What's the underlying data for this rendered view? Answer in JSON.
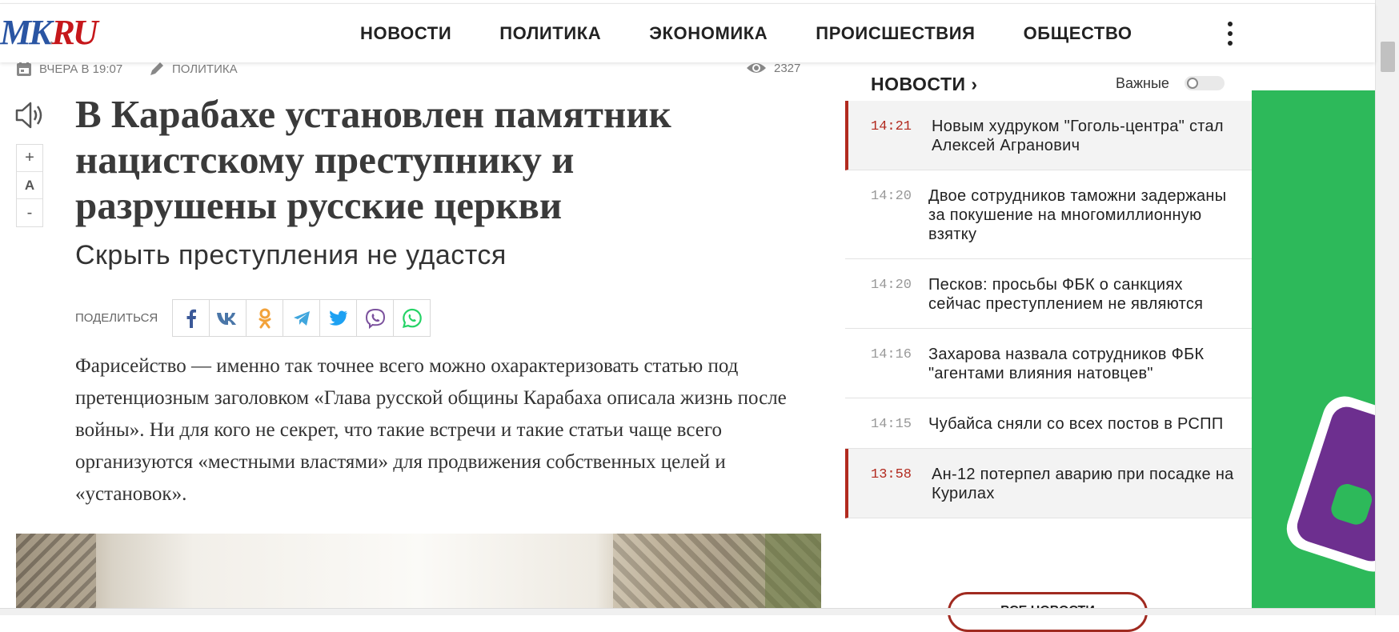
{
  "logo": {
    "mk": "MK",
    "dot": ".",
    "ru": "RU"
  },
  "nav": {
    "items": [
      {
        "label": "НОВОСТИ"
      },
      {
        "label": "ПОЛИТИКА"
      },
      {
        "label": "ЭКОНОМИКА"
      },
      {
        "label": "ПРОИСШЕСТВИЯ"
      },
      {
        "label": "ОБЩЕСТВО"
      }
    ],
    "more_icon": "kebab-menu-icon"
  },
  "article": {
    "date": "ВЧЕРА В 19:07",
    "date_icon": "calendar-icon",
    "rubric": "ПОЛИТИКА",
    "rubric_icon": "pencil-icon",
    "views": "2327",
    "views_icon": "eye-icon",
    "headline": "В Карабахе установлен памятник нацистскому преступнику и разрушены русские церкви",
    "subheadline": "Скрыть преступления не удастся",
    "share_label": "ПОДЕЛИТЬСЯ",
    "share_buttons": [
      {
        "name": "facebook",
        "glyph": "f",
        "color": "#3b5998"
      },
      {
        "name": "vk",
        "glyph": "VK",
        "color": "#4a76a8"
      },
      {
        "name": "odnoklassniki",
        "glyph": "OK",
        "color": "#f2a23a"
      },
      {
        "name": "telegram",
        "glyph": "TG",
        "color": "#40a6dd"
      },
      {
        "name": "twitter",
        "glyph": "TW",
        "color": "#1da1f2"
      },
      {
        "name": "viber",
        "glyph": "VB",
        "color": "#7b519d"
      },
      {
        "name": "whatsapp",
        "glyph": "WA",
        "color": "#25d366"
      }
    ],
    "lead": "Фарисейство — именно так точнее всего можно охарактеризовать статью под претенциозным заголовком «Глава русской общины Карабаха описала жизнь после войны». Ни для кого не секрет, что такие встречи и такие статьи чаще всего организуются «местными властями» для продвижения собственных целей и «установок».",
    "font_controls": {
      "increase": "+",
      "label": "A",
      "decrease": "-"
    },
    "audio_icon": "speaker-icon"
  },
  "sidebar": {
    "title": "НОВОСТИ ›",
    "toggle_label": "Важные",
    "toggle_on": false,
    "news": [
      {
        "time": "14:21",
        "title": "Новым худруком \"Гоголь-центра\" стал Алексей Агранович",
        "hot": true
      },
      {
        "time": "14:20",
        "title": "Двое сотрудников таможни задержаны за покушение на многомиллионную взятку",
        "hot": false
      },
      {
        "time": "14:20",
        "title": "Песков: просьбы ФБК о санкциях сейчас преступлением не являются",
        "hot": false
      },
      {
        "time": "14:16",
        "title": "Захарова назвала сотрудников ФБК \"агентами влияния натовцев\"",
        "hot": false
      },
      {
        "time": "14:15",
        "title": "Чубайса сняли со всех постов в РСПП",
        "hot": false
      },
      {
        "time": "13:58",
        "title": "Ан-12 потерпел аварию при посадке на Курилах",
        "hot": true
      }
    ],
    "all_news_label": "ВСЕ НОВОСТИ"
  },
  "colors": {
    "accent_red": "#b22a1f",
    "logo_blue": "#2a55a3",
    "logo_red": "#c6171b",
    "ad_green": "#2db95a",
    "ad_purple": "#6d2f8f"
  }
}
